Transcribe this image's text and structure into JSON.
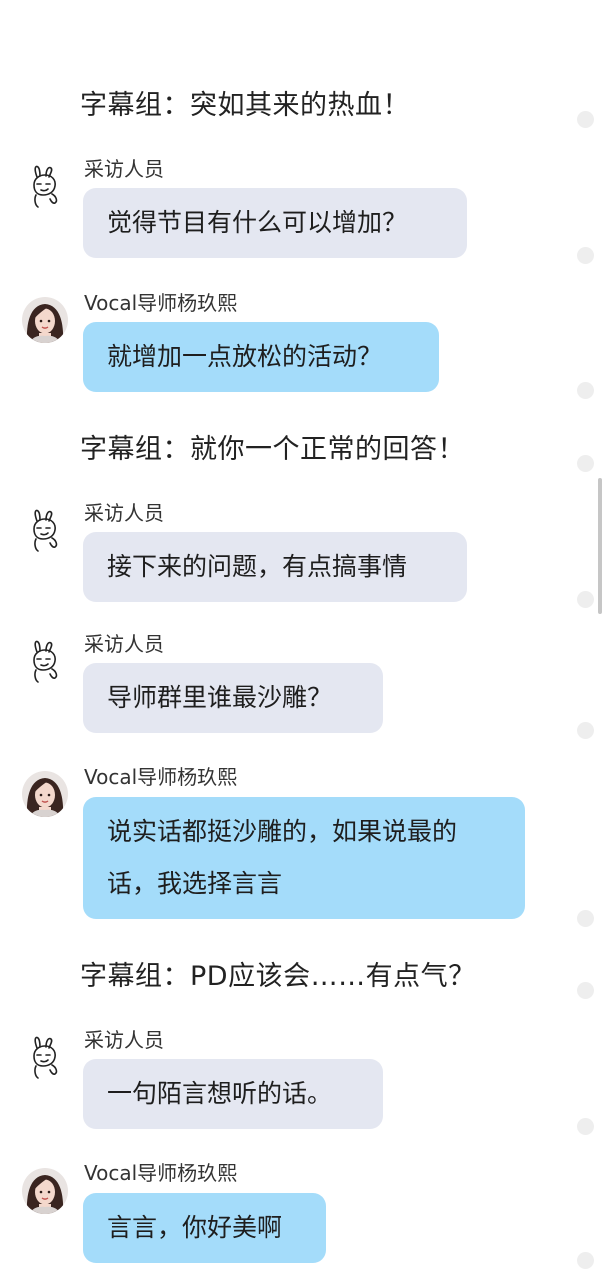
{
  "colors": {
    "interviewer_bubble": "#e4e7f1",
    "mentor_bubble": "#a4dcfa",
    "timeline_dot": "#eeeeee"
  },
  "icons": {
    "interviewer_avatar": "rabbit-doodle-icon",
    "mentor_avatar": "woman-portrait-avatar"
  },
  "thread": {
    "caption_1": "字幕组：突如其来的热血！",
    "msg_1": {
      "sender": "采访人员",
      "text": "觉得节目有什么可以增加？"
    },
    "msg_2": {
      "sender": "Vocal导师杨玖熙",
      "text": "就增加一点放松的活动？"
    },
    "caption_2": "字幕组：就你一个正常的回答！",
    "msg_3": {
      "sender": "采访人员",
      "text": "接下来的问题，有点搞事情"
    },
    "msg_4": {
      "sender": "采访人员",
      "text": "导师群里谁最沙雕？"
    },
    "msg_5": {
      "sender": "Vocal导师杨玖熙",
      "text_line_1": "说实话都挺沙雕的，如果说最的",
      "text_line_2": "话，我选择言言"
    },
    "caption_3": "字幕组：PD应该会……有点气？",
    "msg_6": {
      "sender": "采访人员",
      "text": "一句陌言想听的话。"
    },
    "msg_7": {
      "sender": "Vocal导师杨玖熙",
      "text": "言言，你好美啊"
    }
  }
}
